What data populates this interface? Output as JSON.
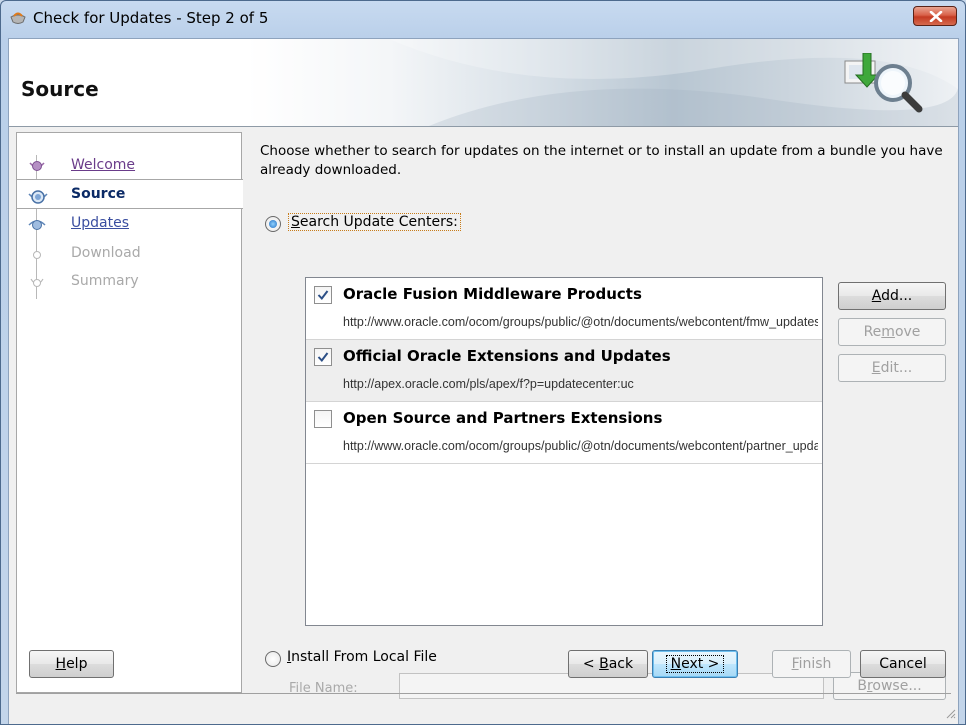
{
  "window": {
    "title": "Check for Updates - Step 2 of 5",
    "icon": "jdeveloper-cup-icon"
  },
  "header": {
    "title": "Source",
    "icon": "update-search-icon"
  },
  "nav": {
    "steps": [
      {
        "label": "Welcome",
        "state": "visited"
      },
      {
        "label": "Source",
        "state": "current"
      },
      {
        "label": "Updates",
        "state": "link"
      },
      {
        "label": "Download",
        "state": "disabled"
      },
      {
        "label": "Summary",
        "state": "disabled"
      }
    ]
  },
  "content": {
    "intro": "Choose whether to search for updates on the internet or to install an update from a bundle you have already downloaded.",
    "search_option": {
      "label_mnemonic": "S",
      "label_rest": "earch Update Centers:",
      "selected": true
    },
    "update_centers": [
      {
        "name": "Oracle Fusion Middleware Products",
        "url": "http://www.oracle.com/ocom/groups/public/@otn/documents/webcontent/fmw_updates.xml",
        "checked": true
      },
      {
        "name": "Official Oracle Extensions and Updates",
        "url": "http://apex.oracle.com/pls/apex/f?p=updatecenter:uc",
        "checked": true
      },
      {
        "name": "Open Source and Partners Extensions",
        "url": "http://www.oracle.com/ocom/groups/public/@otn/documents/webcontent/partner_updates.xml",
        "checked": false
      }
    ],
    "side_buttons": {
      "add": {
        "mnemonic": "A",
        "rest": "dd..."
      },
      "remove": {
        "pre": "Re",
        "mnemonic": "m",
        "rest": "ove"
      },
      "edit": {
        "mnemonic": "E",
        "rest": "dit..."
      }
    },
    "local_option": {
      "label_mnemonic": "I",
      "label_rest": "nstall From Local File",
      "selected": false
    },
    "file_name": {
      "label_mnemonic": "F",
      "label_rest": "ile Name:",
      "value": ""
    },
    "browse": {
      "pre": "B",
      "mnemonic": "r",
      "rest": "owse..."
    }
  },
  "footer": {
    "help": {
      "mnemonic": "H",
      "rest": "elp"
    },
    "back": {
      "pre": "< ",
      "mnemonic": "B",
      "rest": "ack"
    },
    "next": {
      "mnemonic": "N",
      "rest": "ext >"
    },
    "finish": {
      "mnemonic": "F",
      "rest": "inish"
    },
    "cancel": "Cancel"
  },
  "colors": {
    "title_bg": "#c8daf0",
    "link": "#3a4ea0",
    "visited": "#6a3c8a",
    "disabled": "#a9a9a9",
    "close_button": "#c43b22"
  }
}
